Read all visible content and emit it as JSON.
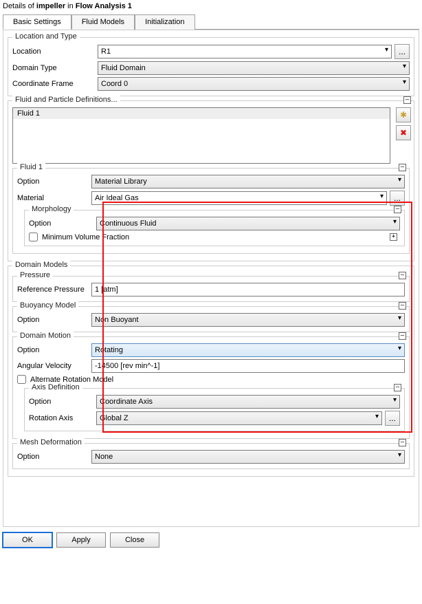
{
  "title_prefix": "Details of ",
  "title_object": "impeller",
  "title_suffix": " in ",
  "title_context": "Flow Analysis 1",
  "tabs": {
    "basic": "Basic Settings",
    "fluid": "Fluid Models",
    "init": "Initialization"
  },
  "location_type": {
    "heading": "Location and Type",
    "location_label": "Location",
    "location_value": "R1",
    "domain_type_label": "Domain Type",
    "domain_type_value": "Fluid Domain",
    "coord_label": "Coordinate Frame",
    "coord_value": "Coord 0"
  },
  "fluid_defs": {
    "heading": "Fluid and Particle Definitions...",
    "list_item": "Fluid 1",
    "sub_heading": "Fluid 1",
    "option_label": "Option",
    "option_value": "Material Library",
    "material_label": "Material",
    "material_value": "Air Ideal Gas",
    "morphology": {
      "heading": "Morphology",
      "option_label": "Option",
      "option_value": "Continuous Fluid",
      "min_vol_label": "Minimum Volume Fraction"
    }
  },
  "domain_models": {
    "heading": "Domain Models",
    "pressure": {
      "heading": "Pressure",
      "ref_label": "Reference Pressure",
      "ref_value": "1 [atm]"
    },
    "buoy": {
      "heading": "Buoyancy Model",
      "opt_label": "Option",
      "opt_value": "Non Buoyant"
    },
    "motion": {
      "heading": "Domain Motion",
      "opt_label": "Option",
      "opt_value": "Rotating",
      "angvel_label": "Angular Velocity",
      "angvel_value": "-14500 [rev min^-1]",
      "alt_label": "Alternate Rotation Model",
      "axisdef": {
        "heading": "Axis Definition",
        "opt_label": "Option",
        "opt_value": "Coordinate Axis",
        "axis_label": "Rotation Axis",
        "axis_value": "Global Z"
      }
    },
    "mesh": {
      "heading": "Mesh Deformation",
      "opt_label": "Option",
      "opt_value": "None"
    }
  },
  "buttons": {
    "ok": "OK",
    "apply": "Apply",
    "close": "Close"
  },
  "icons": {
    "browse": "...",
    "new": "✱",
    "delete": "✖",
    "minus": "–",
    "plus": "+"
  }
}
